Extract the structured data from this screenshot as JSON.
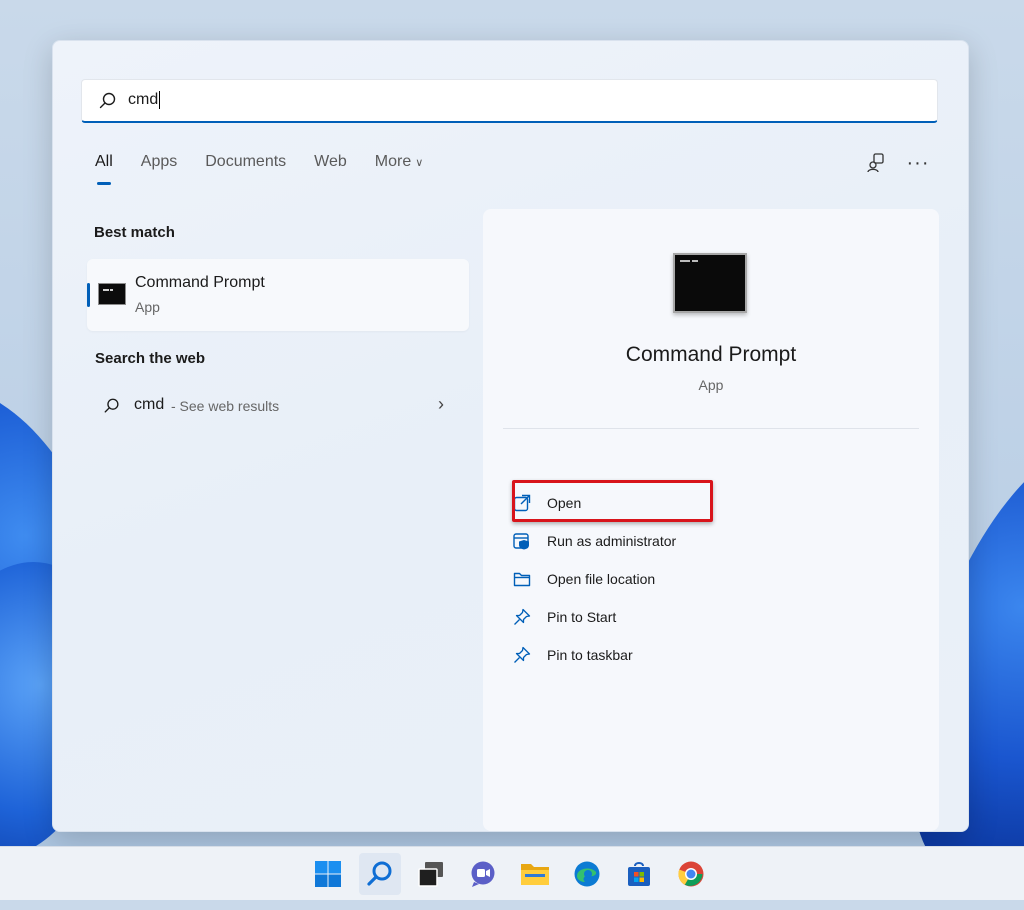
{
  "search": {
    "query": "cmd"
  },
  "tabs": [
    {
      "label": "All",
      "active": true
    },
    {
      "label": "Apps",
      "active": false
    },
    {
      "label": "Documents",
      "active": false
    },
    {
      "label": "Web",
      "active": false
    },
    {
      "label": "More",
      "active": false
    }
  ],
  "toolbar": {
    "more_options": "···"
  },
  "best_match": {
    "heading": "Best match",
    "title": "Command Prompt",
    "subtitle": "App"
  },
  "search_web": {
    "heading": "Search the web",
    "query": "cmd",
    "suffix": "- See web results"
  },
  "detail": {
    "title": "Command Prompt",
    "subtitle": "App",
    "actions": [
      {
        "label": "Open",
        "icon": "open-external-icon"
      },
      {
        "label": "Run as administrator",
        "icon": "admin-shield-icon",
        "highlighted": true
      },
      {
        "label": "Open file location",
        "icon": "folder-icon"
      },
      {
        "label": "Pin to Start",
        "icon": "pin-icon"
      },
      {
        "label": "Pin to taskbar",
        "icon": "pin-icon"
      }
    ]
  },
  "colors": {
    "accent": "#005fb8",
    "highlight_border": "#d8141b"
  },
  "taskbar": {
    "items": [
      "start-icon",
      "search-icon",
      "task-view-icon",
      "chat-icon",
      "file-explorer-icon",
      "edge-icon",
      "store-icon",
      "chrome-icon"
    ]
  }
}
